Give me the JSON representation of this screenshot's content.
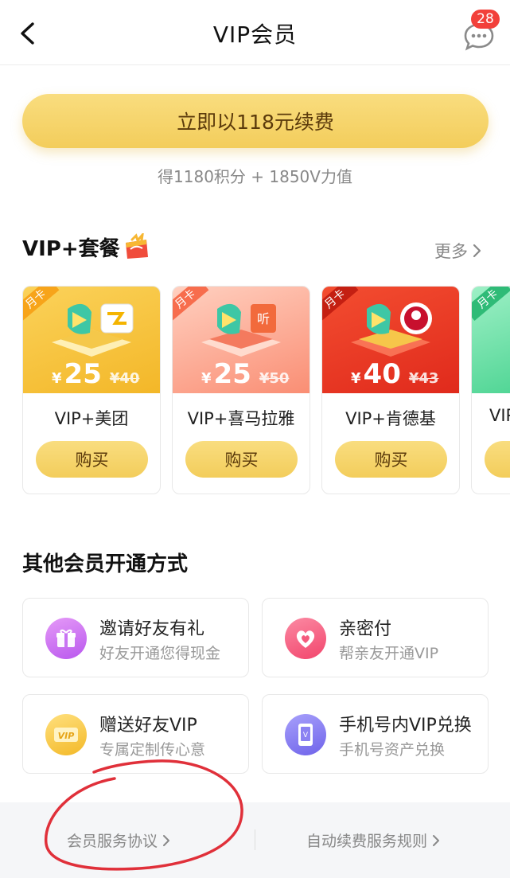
{
  "header": {
    "title": "VIP会员",
    "message_count": "28"
  },
  "renew": {
    "button_label": "立即以118元续费",
    "subtitle": "得1180积分 + 1850V力值"
  },
  "vip_plus": {
    "title": "VIP+套餐",
    "more_label": "更多",
    "cards": [
      {
        "tag": "月卡",
        "price_symbol": "¥",
        "price": "25",
        "original": "¥40",
        "name": "VIP+美团",
        "buy_label": "购买",
        "theme": "#f6c33f"
      },
      {
        "tag": "月卡",
        "price_symbol": "¥",
        "price": "25",
        "original": "¥50",
        "name": "VIP+喜马拉雅",
        "buy_label": "购买",
        "theme": "#fba08a"
      },
      {
        "tag": "月卡",
        "price_symbol": "¥",
        "price": "40",
        "original": "¥43",
        "name": "VIP+肯德基",
        "buy_label": "购买",
        "theme": "#ec3d2a"
      },
      {
        "tag": "月卡",
        "price_symbol": "¥",
        "price": "",
        "original": "",
        "name": "VIP",
        "buy_label": "",
        "theme": "#5fd8a0"
      }
    ]
  },
  "other_methods": {
    "title": "其他会员开通方式",
    "items": [
      {
        "title": "邀请好友有礼",
        "subtitle": "好友开通您得现金",
        "icon": "gift-icon",
        "color": "#c66bf0"
      },
      {
        "title": "亲密付",
        "subtitle": "帮亲友开通VIP",
        "icon": "heart-icon",
        "color": "#f5567a"
      },
      {
        "title": "赠送好友VIP",
        "subtitle": "专属定制传心意",
        "icon": "vip-ticket-icon",
        "color": "#f5c33a"
      },
      {
        "title": "手机号内VIP兑换",
        "subtitle": "手机号资产兑换",
        "icon": "phone-icon",
        "color": "#7d74ef"
      }
    ]
  },
  "footer": {
    "agreement_label": "会员服务协议",
    "auto_renew_label": "自动续费服务规则"
  },
  "colors": {
    "gold": "#f5d168",
    "gold_text": "#5b3a0b",
    "annotation_red": "#e0303a"
  }
}
